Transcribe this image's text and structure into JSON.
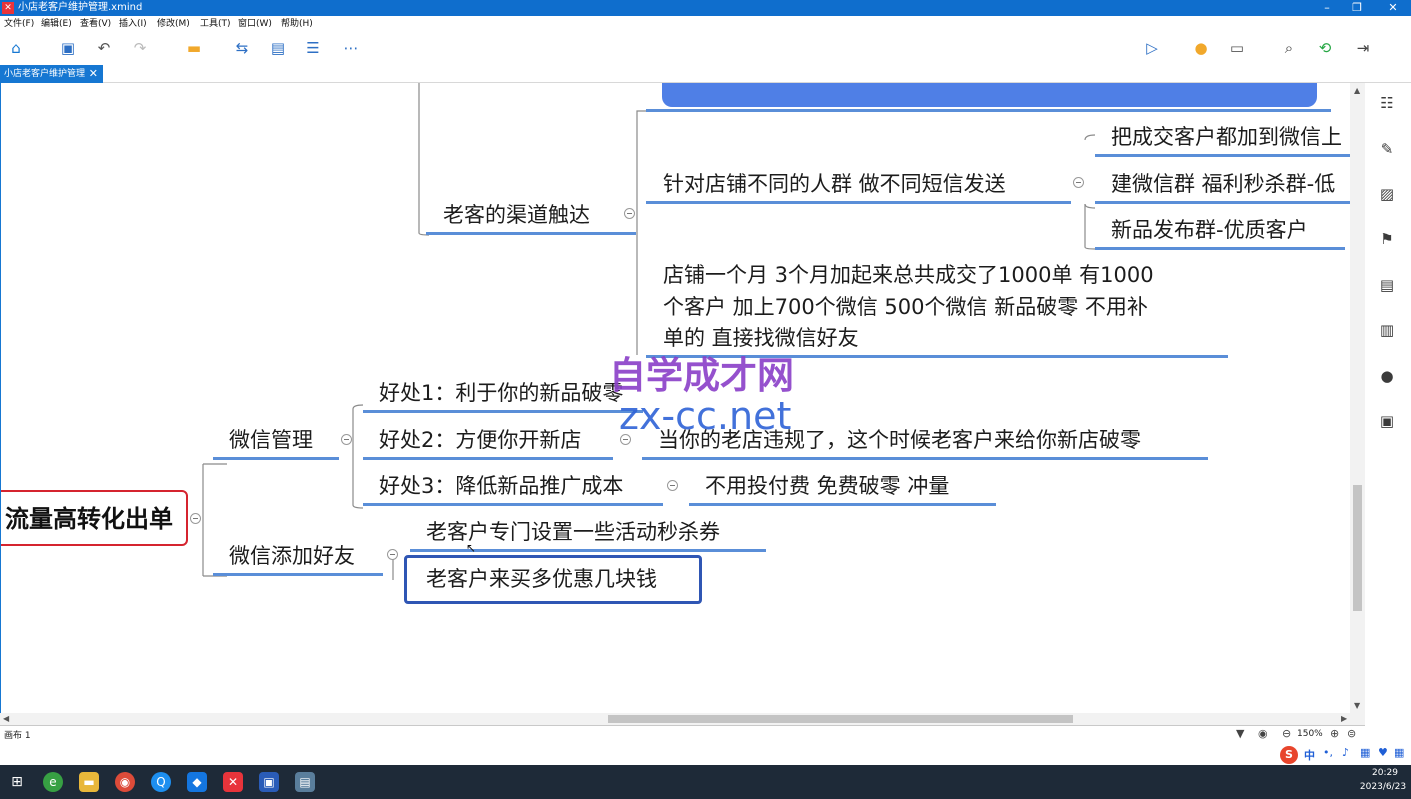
{
  "window": {
    "title": "小店老客户维护管理.xmind"
  },
  "menu": [
    "文件(F)",
    "编辑(E)",
    "查看(V)",
    "插入(I)",
    "修改(M)",
    "工具(T)",
    "窗口(W)",
    "帮助(H)"
  ],
  "tab": {
    "label": "小店老客户维护管理"
  },
  "watermark": {
    "line1": "自学成才网",
    "line2": "zx-cc.net"
  },
  "mindmap": {
    "root": "流量高转化出单",
    "channel_branch": "老客的渠道触达",
    "sms_topic": "针对店铺不同的人群 做不同短信发送",
    "sms_children": [
      "把成交客户都加到微信上",
      "建微信群 福利秒杀群-低",
      "新品发布群-优质客户"
    ],
    "store_note": [
      "店铺一个月 3个月加起来总共成交了1000单 有1000",
      "个客户 加上700个微信 500个微信 新品破零 不用补",
      "单的 直接找微信好友"
    ],
    "wechat_mgmt": "微信管理",
    "benefit1": "好处1：利于你的新品破零",
    "benefit2": "好处2：方便你开新店",
    "benefit2_note": "当你的老店违规了，这个时候老客户来给你新店破零",
    "benefit3": "好处3：降低新品推广成本",
    "benefit3_note": "不用投付费 免费破零 冲量",
    "wechat_add": "微信添加好友",
    "add_child1": "老客户专门设置一些活动秒杀券",
    "add_child2": "老客户来买多优惠几块钱"
  },
  "status": {
    "sheet": "画布 1",
    "zoom": "150%"
  },
  "taskbar": {
    "clock_time": "20:29",
    "clock_date": "2023/6/23",
    "ime": "中"
  },
  "colors": {
    "accent": "#1677d2",
    "branch_line": "#5a8ed8",
    "root_border": "#d5242f",
    "selected_border": "#2f56b4"
  }
}
